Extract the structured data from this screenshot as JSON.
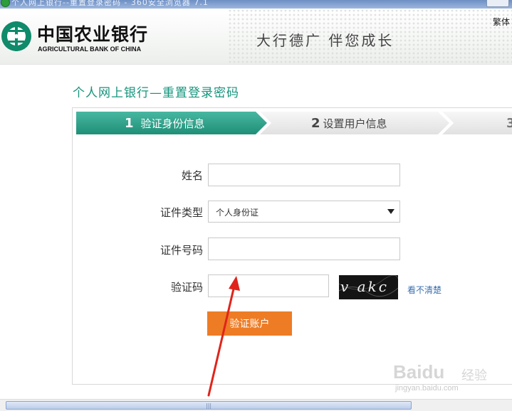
{
  "browser": {
    "title_text": "个人网上银行--重置登录密码 - 360安全浏览器 7.1"
  },
  "header": {
    "bank_name_cn": "中国农业银行",
    "bank_name_en": "AGRICULTURAL BANK OF CHINA",
    "slogan": "大行德广  伴您成长",
    "lang_link": "繁体"
  },
  "page": {
    "title": "个人网上银行—重置登录密码"
  },
  "steps": [
    {
      "num": "1",
      "label": "验证身份信息",
      "active": true
    },
    {
      "num": "2",
      "label": "设置用户信息",
      "active": false
    },
    {
      "num": "3",
      "label": "",
      "active": false
    }
  ],
  "form": {
    "name_label": "姓名",
    "name_value": "",
    "id_type_label": "证件类型",
    "id_type_value": "个人身份证",
    "id_number_label": "证件号码",
    "id_number_value": "",
    "captcha_label": "验证码",
    "captcha_value": "",
    "captcha_image_text": "v akc",
    "refresh_link": "看不清楚",
    "submit_label": "验证账户"
  },
  "watermark": {
    "brand": "Baidu",
    "jingyan": "经验",
    "url": "jingyan.baidu.com"
  },
  "colors": {
    "accent_green": "#14947c",
    "step_active": "#2aa18a",
    "button_orange": "#ee7c25",
    "annotation_arrow": "#e0241b"
  }
}
